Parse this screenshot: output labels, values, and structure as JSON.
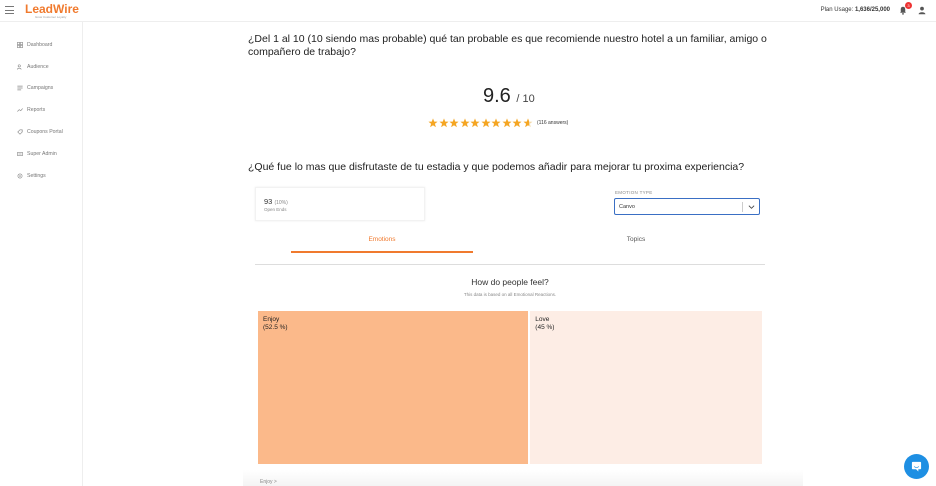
{
  "header": {
    "logo_text": "LeadWire",
    "logo_tagline": "Grow Customer Loyalty",
    "plan_label": "Plan Usage:",
    "plan_value": "1,636/25,000",
    "notification_count": "3"
  },
  "sidebar": {
    "items": [
      {
        "label": "Dashboard",
        "icon": "dashboard-icon"
      },
      {
        "label": "Audience",
        "icon": "audience-icon"
      },
      {
        "label": "Campaigns",
        "icon": "campaigns-icon"
      },
      {
        "label": "Reports",
        "icon": "reports-icon"
      },
      {
        "label": "Coupons Portal",
        "icon": "coupon-icon"
      },
      {
        "label": "Super Admin",
        "icon": "admin-icon"
      },
      {
        "label": "Settings",
        "icon": "settings-icon"
      }
    ]
  },
  "question1": {
    "text": "¿Del 1 al 10 (10 siendo mas probable) qué tan probable es que recomiende nuestro hotel a un familiar, amigo o compañero de trabajo?",
    "score": "9.6",
    "score_denominator": "/ 10",
    "answers": "(116 answers)",
    "rating_fraction": 0.96,
    "star_color": "#f5a623"
  },
  "question2": {
    "text": "¿Qué fue lo mas que disfrutaste de tu estadia y que podemos añadir para mejorar tu proxima experiencia?",
    "count": "93",
    "percent": "(10%)",
    "count_label": "Open Ends",
    "emotion_type_label": "EMOTION TYPE",
    "emotion_type_value": "Canvo",
    "tabs": {
      "emotions": "Emotions",
      "topics": "Topics"
    },
    "chart_title": "How do people feel?",
    "chart_subtitle": "This data is based on all Emotional Reactions.",
    "bottom_text": "Enjoy >"
  },
  "chart_data": {
    "type": "treemap",
    "items": [
      {
        "label": "Enjoy",
        "percent_text": "(52.5 %)",
        "value": 52.5,
        "color": "#fbb98a"
      },
      {
        "label": "Love",
        "percent_text": "(45 %)",
        "value": 45,
        "color": "#fdede5"
      }
    ]
  },
  "colors": {
    "accent": "#f07a2e",
    "select_border": "#3a6fc4",
    "chat_button": "#1e8fe3"
  }
}
